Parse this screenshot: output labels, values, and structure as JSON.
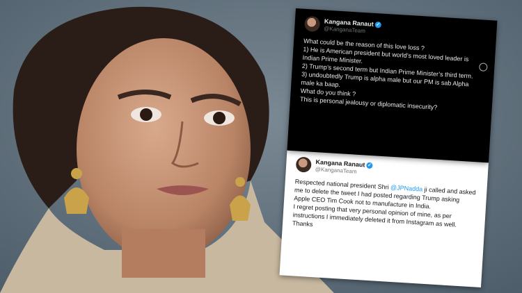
{
  "tweet1": {
    "name": "Kangana Ranaut",
    "handle": "@KanganaTeam",
    "text": "What could be the reason of this love loss ?\n1) He is American president but world’s most loved leader is Indian Prime Minister.\n2) Trump’s second term but Indian Prime Minister’s third term.\n3) undoubtedly Trump is alpha male but our PM is sab Alpha male ka baap.\nWhat do you think ?\nThis is personal jealousy or diplomatic insecurity?"
  },
  "tweet2": {
    "name": "Kangana Ranaut",
    "handle": "@KanganaTeam",
    "text_before": "Respected national president Shri ",
    "mention": "@JPNadda",
    "text_after": " ji called and asked me to delete the tweet I had posted regarding Trump asking  Apple CEO Tim Cook not to manufacture in India.\nI regret posting that very personal opinion of mine, as per instructions I immediately deleted it from Instagram as well. Thanks"
  },
  "colors": {
    "verified": "#1d9bf0",
    "dark_card": "#000000",
    "light_card": "#ffffff"
  }
}
